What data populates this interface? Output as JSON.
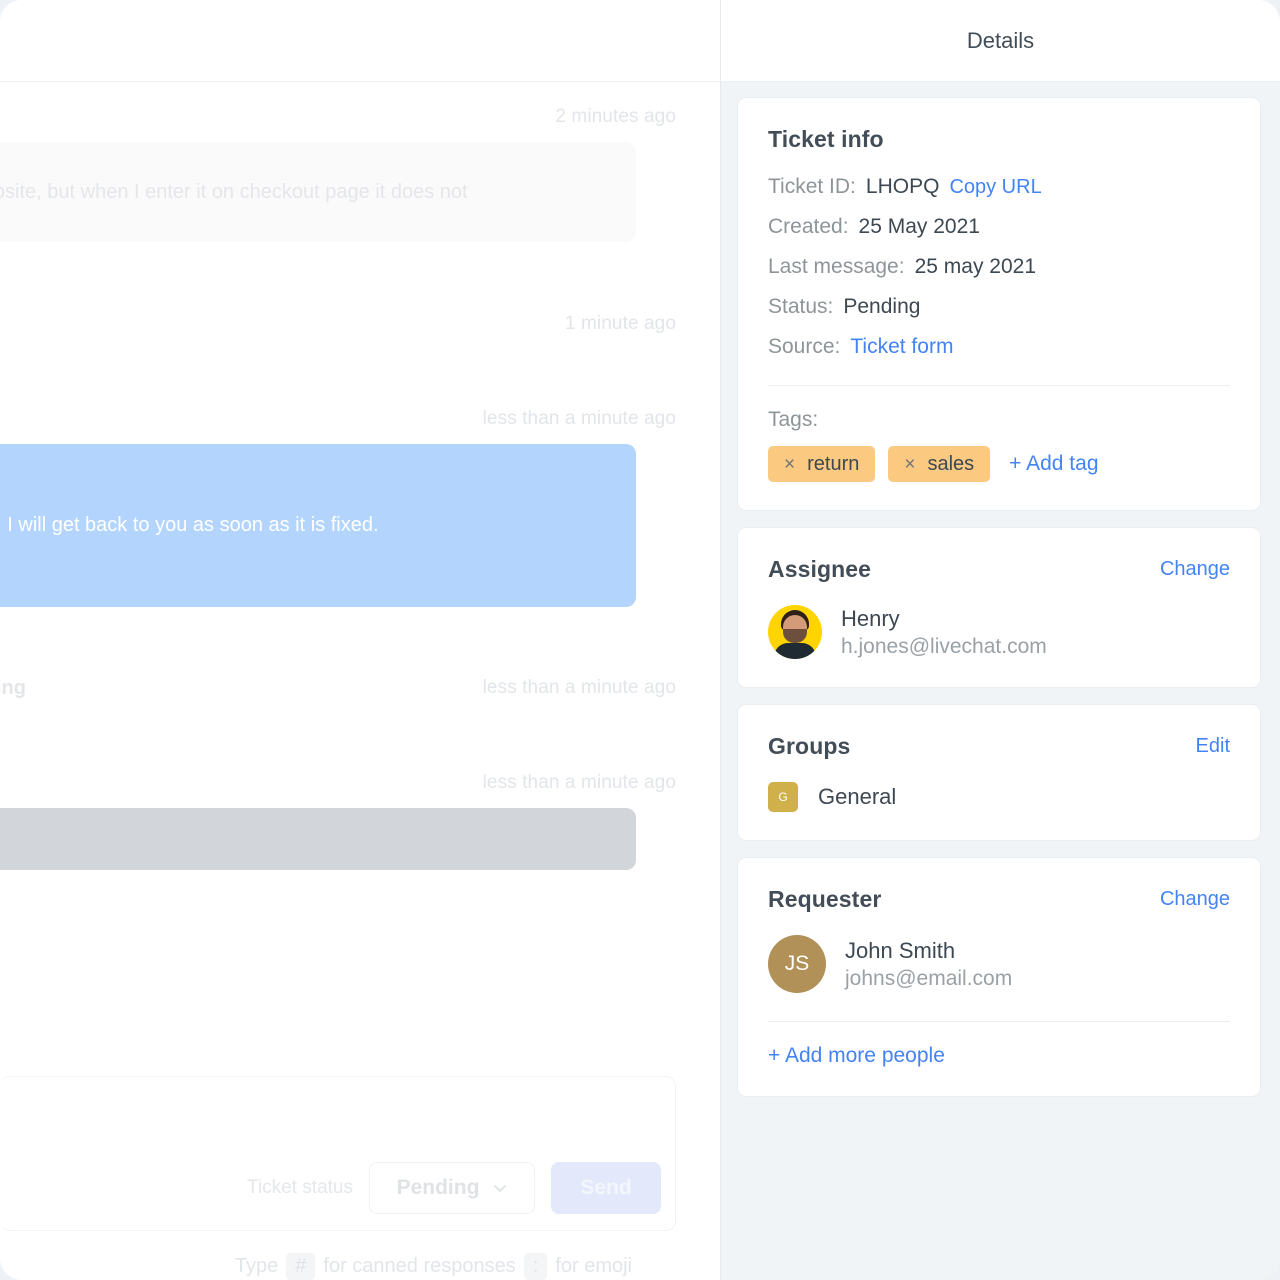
{
  "chat": {
    "messages": [
      {
        "time": "2 minutes ago",
        "text": "ur website, but when I enter it on checkout page it does not",
        "kind": "incoming"
      },
      {
        "time": "1 minute ago",
        "text": "",
        "kind": "time-only"
      },
      {
        "time": "less than a minute ago",
        "text": "erator, I will get back to you as soon as it is fixed.",
        "kind": "outgoing"
      },
      {
        "time": "less than a minute ago",
        "text": "ing",
        "kind": "time-only"
      },
      {
        "time": "less than a minute ago",
        "text": "",
        "kind": "grey"
      }
    ],
    "composer": {
      "ticket_status_label": "Ticket status",
      "status_value": "Pending",
      "send_label": "Send",
      "hint_prefix": "Type",
      "hint_key_hash": "#",
      "hint_middle": "for canned responses",
      "hint_key_colon": ":",
      "hint_suffix": "for emoji"
    }
  },
  "details": {
    "title": "Details",
    "ticket_info": {
      "title": "Ticket info",
      "ticket_id_label": "Ticket ID:",
      "ticket_id_value": "LHOPQ",
      "copy_url_label": "Copy URL",
      "created_label": "Created:",
      "created_value": "25 May 2021",
      "last_message_label": "Last message:",
      "last_message_value": "25 may 2021",
      "status_label": "Status:",
      "status_value": "Pending",
      "source_label": "Source:",
      "source_value": "Ticket form",
      "tags_label": "Tags:",
      "tags": [
        {
          "label": "return",
          "remove_glyph": "×"
        },
        {
          "label": "sales",
          "remove_glyph": "×"
        }
      ],
      "add_tag_label": "+ Add tag"
    },
    "assignee": {
      "title": "Assignee",
      "change_label": "Change",
      "name": "Henry",
      "email": "h.jones@livechat.com"
    },
    "groups": {
      "title": "Groups",
      "edit_label": "Edit",
      "badge_letter": "G",
      "name": "General"
    },
    "requester": {
      "title": "Requester",
      "change_label": "Change",
      "initials": "JS",
      "name": "John Smith",
      "email": "johns@email.com",
      "add_more_label": "+ Add more people"
    }
  },
  "colors": {
    "link_blue": "#4384f5",
    "tag_amber": "#fbc97f",
    "outgoing_bubble": "#b3d4fc",
    "grey_bubble": "#d2d5d9",
    "avatar_yellow": "#ffd400",
    "initials_brown": "#b19158",
    "group_badge_gold": "#cfb04a",
    "panel_bg": "#f1f4f7"
  }
}
